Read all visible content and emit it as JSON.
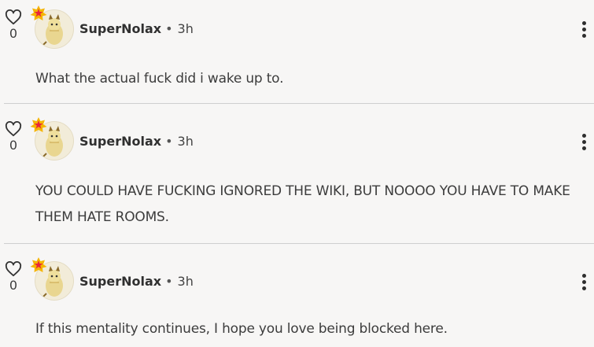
{
  "comments": [
    {
      "likes": "0",
      "author": "SuperNolax",
      "separator": "•",
      "time": "3h",
      "text": "What the actual fuck did i wake up to."
    },
    {
      "likes": "0",
      "author": "SuperNolax",
      "separator": "•",
      "time": "3h",
      "text": "YOU COULD HAVE FUCKING IGNORED THE WIKI, BUT NOOOO YOU HAVE TO MAKE THEM HATE ROOMS."
    },
    {
      "likes": "0",
      "author": "SuperNolax",
      "separator": "•",
      "time": "3h",
      "text": "If this mentality continues, I hope you love being blocked here."
    }
  ],
  "icons": {
    "like": "heart-outline-icon",
    "badge": "star-badge-icon",
    "menu": "more-vertical-icon"
  },
  "colors": {
    "badge_outer": "#f5b400",
    "badge_star": "#e8253b",
    "background": "#f7f6f5"
  }
}
